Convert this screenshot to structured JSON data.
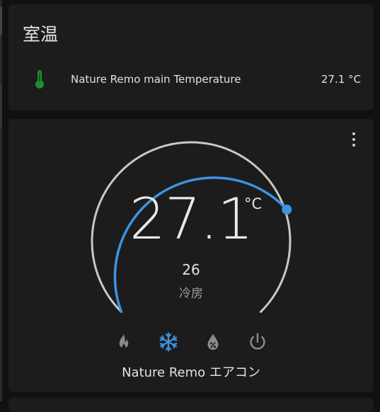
{
  "entities_card": {
    "title": "室温",
    "rows": [
      {
        "icon": "thermometer-icon",
        "name": "Nature Remo main Temperature",
        "state": "27.1 °C",
        "icon_color": "#1e8e2e"
      }
    ]
  },
  "thermostat": {
    "current_temperature": "27.1",
    "unit": "°C",
    "target_temperature": "26",
    "hvac_mode_label": "冷房",
    "device_name": "Nature Remo エアコン",
    "modes": [
      {
        "name": "heat",
        "icon": "fire-icon",
        "active": false
      },
      {
        "name": "cool",
        "icon": "snowflake-icon",
        "active": true
      },
      {
        "name": "dry",
        "icon": "water-percent-icon",
        "active": false
      },
      {
        "name": "off",
        "icon": "power-icon",
        "active": false
      }
    ],
    "colors": {
      "active_arc": "#3d93e0",
      "inactive_arc": "#c8c8c8",
      "active_mode": "#3d93e0",
      "inactive_mode": "#8a8a8a"
    }
  }
}
